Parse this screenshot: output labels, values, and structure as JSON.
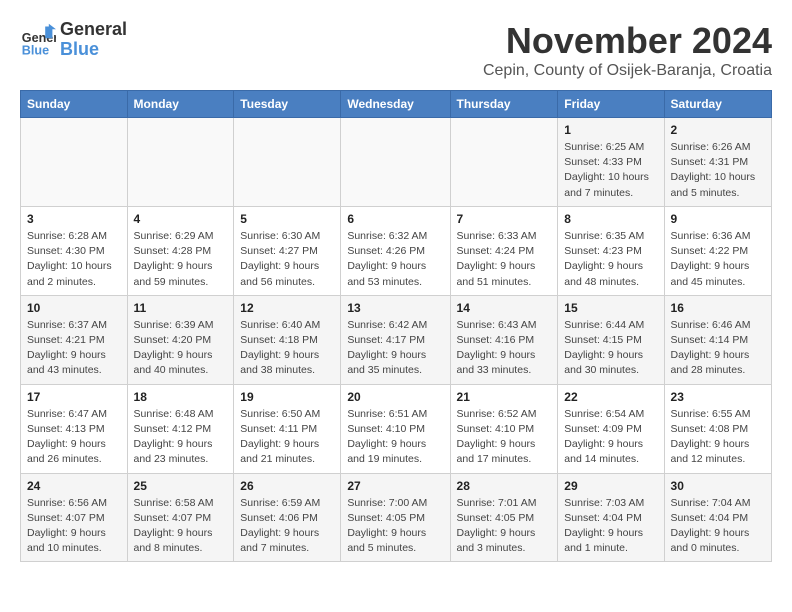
{
  "logo": {
    "line1": "General",
    "line2": "Blue"
  },
  "header": {
    "title": "November 2024",
    "subtitle": "Cepin, County of Osijek-Baranja, Croatia"
  },
  "columns": [
    "Sunday",
    "Monday",
    "Tuesday",
    "Wednesday",
    "Thursday",
    "Friday",
    "Saturday"
  ],
  "weeks": [
    {
      "days": [
        {
          "num": "",
          "info": ""
        },
        {
          "num": "",
          "info": ""
        },
        {
          "num": "",
          "info": ""
        },
        {
          "num": "",
          "info": ""
        },
        {
          "num": "",
          "info": ""
        },
        {
          "num": "1",
          "info": "Sunrise: 6:25 AM\nSunset: 4:33 PM\nDaylight: 10 hours and 7 minutes."
        },
        {
          "num": "2",
          "info": "Sunrise: 6:26 AM\nSunset: 4:31 PM\nDaylight: 10 hours and 5 minutes."
        }
      ]
    },
    {
      "days": [
        {
          "num": "3",
          "info": "Sunrise: 6:28 AM\nSunset: 4:30 PM\nDaylight: 10 hours and 2 minutes."
        },
        {
          "num": "4",
          "info": "Sunrise: 6:29 AM\nSunset: 4:28 PM\nDaylight: 9 hours and 59 minutes."
        },
        {
          "num": "5",
          "info": "Sunrise: 6:30 AM\nSunset: 4:27 PM\nDaylight: 9 hours and 56 minutes."
        },
        {
          "num": "6",
          "info": "Sunrise: 6:32 AM\nSunset: 4:26 PM\nDaylight: 9 hours and 53 minutes."
        },
        {
          "num": "7",
          "info": "Sunrise: 6:33 AM\nSunset: 4:24 PM\nDaylight: 9 hours and 51 minutes."
        },
        {
          "num": "8",
          "info": "Sunrise: 6:35 AM\nSunset: 4:23 PM\nDaylight: 9 hours and 48 minutes."
        },
        {
          "num": "9",
          "info": "Sunrise: 6:36 AM\nSunset: 4:22 PM\nDaylight: 9 hours and 45 minutes."
        }
      ]
    },
    {
      "days": [
        {
          "num": "10",
          "info": "Sunrise: 6:37 AM\nSunset: 4:21 PM\nDaylight: 9 hours and 43 minutes."
        },
        {
          "num": "11",
          "info": "Sunrise: 6:39 AM\nSunset: 4:20 PM\nDaylight: 9 hours and 40 minutes."
        },
        {
          "num": "12",
          "info": "Sunrise: 6:40 AM\nSunset: 4:18 PM\nDaylight: 9 hours and 38 minutes."
        },
        {
          "num": "13",
          "info": "Sunrise: 6:42 AM\nSunset: 4:17 PM\nDaylight: 9 hours and 35 minutes."
        },
        {
          "num": "14",
          "info": "Sunrise: 6:43 AM\nSunset: 4:16 PM\nDaylight: 9 hours and 33 minutes."
        },
        {
          "num": "15",
          "info": "Sunrise: 6:44 AM\nSunset: 4:15 PM\nDaylight: 9 hours and 30 minutes."
        },
        {
          "num": "16",
          "info": "Sunrise: 6:46 AM\nSunset: 4:14 PM\nDaylight: 9 hours and 28 minutes."
        }
      ]
    },
    {
      "days": [
        {
          "num": "17",
          "info": "Sunrise: 6:47 AM\nSunset: 4:13 PM\nDaylight: 9 hours and 26 minutes."
        },
        {
          "num": "18",
          "info": "Sunrise: 6:48 AM\nSunset: 4:12 PM\nDaylight: 9 hours and 23 minutes."
        },
        {
          "num": "19",
          "info": "Sunrise: 6:50 AM\nSunset: 4:11 PM\nDaylight: 9 hours and 21 minutes."
        },
        {
          "num": "20",
          "info": "Sunrise: 6:51 AM\nSunset: 4:10 PM\nDaylight: 9 hours and 19 minutes."
        },
        {
          "num": "21",
          "info": "Sunrise: 6:52 AM\nSunset: 4:10 PM\nDaylight: 9 hours and 17 minutes."
        },
        {
          "num": "22",
          "info": "Sunrise: 6:54 AM\nSunset: 4:09 PM\nDaylight: 9 hours and 14 minutes."
        },
        {
          "num": "23",
          "info": "Sunrise: 6:55 AM\nSunset: 4:08 PM\nDaylight: 9 hours and 12 minutes."
        }
      ]
    },
    {
      "days": [
        {
          "num": "24",
          "info": "Sunrise: 6:56 AM\nSunset: 4:07 PM\nDaylight: 9 hours and 10 minutes."
        },
        {
          "num": "25",
          "info": "Sunrise: 6:58 AM\nSunset: 4:07 PM\nDaylight: 9 hours and 8 minutes."
        },
        {
          "num": "26",
          "info": "Sunrise: 6:59 AM\nSunset: 4:06 PM\nDaylight: 9 hours and 7 minutes."
        },
        {
          "num": "27",
          "info": "Sunrise: 7:00 AM\nSunset: 4:05 PM\nDaylight: 9 hours and 5 minutes."
        },
        {
          "num": "28",
          "info": "Sunrise: 7:01 AM\nSunset: 4:05 PM\nDaylight: 9 hours and 3 minutes."
        },
        {
          "num": "29",
          "info": "Sunrise: 7:03 AM\nSunset: 4:04 PM\nDaylight: 9 hours and 1 minute."
        },
        {
          "num": "30",
          "info": "Sunrise: 7:04 AM\nSunset: 4:04 PM\nDaylight: 9 hours and 0 minutes."
        }
      ]
    }
  ]
}
